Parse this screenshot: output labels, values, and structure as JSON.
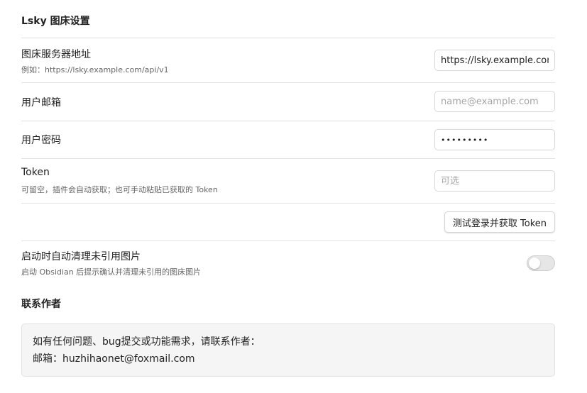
{
  "section_title": "Lsky 图床设置",
  "server": {
    "title": "图床服务器地址",
    "desc": "例如：https://lsky.example.com/api/v1",
    "value": "https://lsky.example.com"
  },
  "email": {
    "title": "用户邮箱",
    "placeholder": "name@example.com"
  },
  "password": {
    "title": "用户密码",
    "value": "•••••••••"
  },
  "token": {
    "title": "Token",
    "desc": "可留空，插件会自动获取；也可手动粘贴已获取的 Token",
    "placeholder": "可选"
  },
  "test_button": {
    "label": "测试登录并获取 Token"
  },
  "auto_clean": {
    "title": "启动时自动清理未引用图片",
    "desc": "启动 Obsidian 后提示确认并清理未引用的图床图片",
    "enabled": false
  },
  "contact": {
    "title": "联系作者",
    "line1": "如有任何问题、bug提交或功能需求，请联系作者：",
    "line2": "邮箱：huzhihaonet@foxmail.com"
  }
}
